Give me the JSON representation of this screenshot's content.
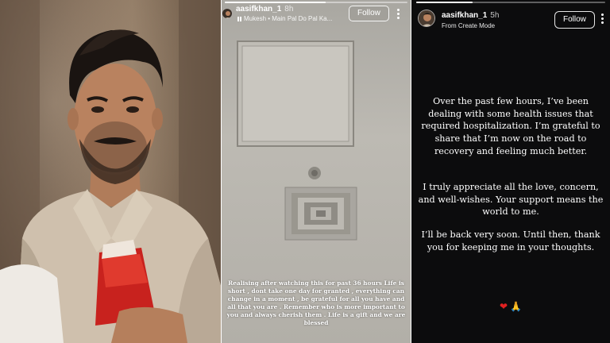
{
  "colors": {
    "story_dark_bg": "#0c0c0d",
    "heart": "#e02020",
    "text_light": "#ffffff"
  },
  "ceiling_story": {
    "username": "aasifkhan_1",
    "timestamp": "8h",
    "music_line": "Mukesh • Main Pal Do Pal Ka...",
    "follow_label": "Follow",
    "progress": 0.55,
    "caption": "Realising after watching this for past 36 hours Life is short , dont take one day for granted , everything can change in a moment , be grateful for all you have and all that you are . Remember who is more important to you and always cherish them . Life is a gift and we are blessed"
  },
  "text_story": {
    "username": "aasifkhan_1",
    "timestamp": "5h",
    "source": "From Create Mode",
    "follow_label": "Follow",
    "progress": 0.3,
    "paragraphs": [
      "Over the past few hours, I’ve been dealing with some health issues that required hospitalization. I’m grateful to share that I’m now on the road to recovery and feeling much better.",
      "I truly appreciate all the love, concern, and well-wishes. Your support means the world to me.",
      "I’ll be back very soon. Until then, thank you for keeping me in your thoughts."
    ],
    "emojis": [
      "heart-icon",
      "folded-hands-icon"
    ]
  }
}
